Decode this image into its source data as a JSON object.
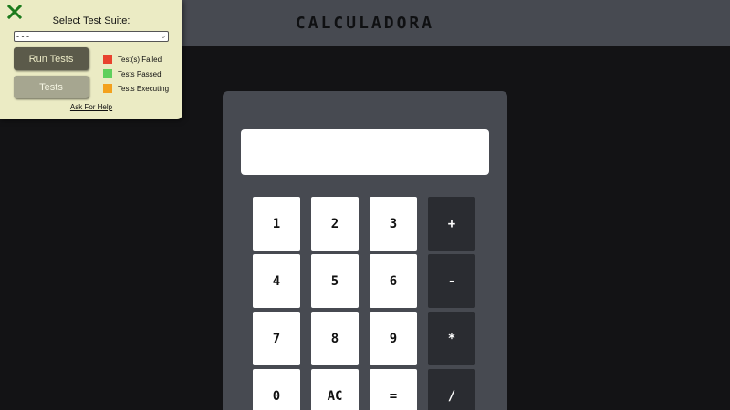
{
  "header": {
    "title": "CALCULADORA"
  },
  "calculator": {
    "display_value": "",
    "keys": [
      {
        "label": "1",
        "type": "digit"
      },
      {
        "label": "2",
        "type": "digit"
      },
      {
        "label": "3",
        "type": "digit"
      },
      {
        "label": "+",
        "type": "op"
      },
      {
        "label": "4",
        "type": "digit"
      },
      {
        "label": "5",
        "type": "digit"
      },
      {
        "label": "6",
        "type": "digit"
      },
      {
        "label": "-",
        "type": "op"
      },
      {
        "label": "7",
        "type": "digit"
      },
      {
        "label": "8",
        "type": "digit"
      },
      {
        "label": "9",
        "type": "digit"
      },
      {
        "label": "*",
        "type": "op"
      },
      {
        "label": "0",
        "type": "digit"
      },
      {
        "label": "AC",
        "type": "digit"
      },
      {
        "label": "=",
        "type": "digit"
      },
      {
        "label": "/",
        "type": "op"
      }
    ]
  },
  "test_panel": {
    "suite_label": "Select Test Suite:",
    "suite_selected": "- - -",
    "run_button": "Run Tests",
    "tests_button": "Tests",
    "legend": [
      {
        "label": "Test(s) Failed",
        "color": "#e8432e"
      },
      {
        "label": "Tests Passed",
        "color": "#5fd05c"
      },
      {
        "label": "Tests Executing",
        "color": "#f3a11d"
      }
    ],
    "help_link": "Ask For Help",
    "close_icon": "close-x-icon",
    "close_color": "#1c7a1c"
  },
  "colors": {
    "page_background": "#131315",
    "header_background": "#474a51",
    "calculator_body": "#474a51",
    "key_digit": "#ffffff",
    "key_operator": "#2a2c31",
    "panel_background": "#ebebc4"
  }
}
